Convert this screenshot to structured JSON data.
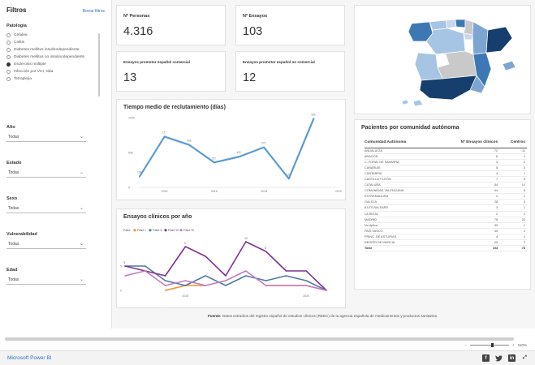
{
  "filters": {
    "title": "Filtros",
    "clear_label": "Borrar filtros",
    "patologia": {
      "label": "Patología",
      "options": [
        {
          "label": "Cefalea",
          "selected": false
        },
        {
          "label": "Colitis",
          "selected": false
        },
        {
          "label": "Diabetes mellitus insulinodependiente",
          "selected": false
        },
        {
          "label": "Diabetes mellitus no insulinodependiente",
          "selected": false
        },
        {
          "label": "Esclerosis múltiple",
          "selected": true
        },
        {
          "label": "Infección por VIH, sida",
          "selected": false
        },
        {
          "label": "Tetraplejia",
          "selected": false
        }
      ]
    },
    "ano": {
      "label": "Año",
      "value": "Todas"
    },
    "estado": {
      "label": "Estado",
      "value": "Todas"
    },
    "sexo": {
      "label": "Sexo",
      "value": "Todas"
    },
    "vulnerabilidad": {
      "label": "Vulnerabilidad",
      "value": "Todas"
    },
    "edad": {
      "label": "Edad",
      "value": "Todas"
    }
  },
  "kpis": {
    "personas": {
      "label": "Nº Personas",
      "value": "4.316"
    },
    "ensayos": {
      "label": "Nº Ensayos",
      "value": "103"
    },
    "promotor_comercial": {
      "label": "Ensayos promotor español comercial",
      "value": "13"
    },
    "promotor_no_comercial": {
      "label": "Ensayos promotor español no comercial",
      "value": "12"
    }
  },
  "map": {
    "regions": [
      {
        "name": "Galicia",
        "color": "#3d78b4"
      },
      {
        "name": "Asturias",
        "color": "#a6c4e3"
      },
      {
        "name": "Cantabria",
        "color": "#c6d8ec"
      },
      {
        "name": "País Vasco",
        "color": "#3d78b4"
      },
      {
        "name": "Navarra",
        "color": "#c9c9c9"
      },
      {
        "name": "Aragón",
        "color": "#7da5d1"
      },
      {
        "name": "Cataluña",
        "color": "#163f6e"
      },
      {
        "name": "Castilla y León",
        "color": "#a6c4e3"
      },
      {
        "name": "La Rioja",
        "color": "#c6d8ec"
      },
      {
        "name": "Madrid",
        "color": "#163f6e"
      },
      {
        "name": "Castilla-La Mancha",
        "color": "#c9c9c9"
      },
      {
        "name": "Extremadura",
        "color": "#a6c4e3"
      },
      {
        "name": "Valencia",
        "color": "#3d78b4"
      },
      {
        "name": "Murcia",
        "color": "#7da5d1"
      },
      {
        "name": "Andalucía",
        "color": "#163f6e"
      },
      {
        "name": "Baleares",
        "color": "#7da5d1"
      },
      {
        "name": "Canarias",
        "color": "#a6c4e3"
      }
    ]
  },
  "recruitment_chart": {
    "title": "Tiempo medio de reclutamiento (días)",
    "line_color": "#5b9bd5",
    "chart_data": {
      "type": "line",
      "x": [
        "2014",
        "2015",
        "2016",
        "2017",
        "2018",
        "2019",
        "2020",
        "2021",
        "2022"
      ],
      "x_tick_labels": [
        {
          "label": "2015",
          "index": 1
        },
        {
          "label": "2016",
          "index": 3
        },
        {
          "label": "2018",
          "index": 5
        },
        {
          "label": "2020",
          "index": 8
        }
      ],
      "y_ticks": [
        0,
        500,
        1000
      ],
      "values": [
        156,
        727,
        608,
        357,
        439,
        574,
        125,
        985
      ],
      "ylim": [
        0,
        1000
      ],
      "point_labels": [
        "156",
        "727",
        "608",
        "357",
        "439",
        "574",
        "125",
        "985"
      ]
    }
  },
  "trials_chart": {
    "title": "Ensayos clínicos por año",
    "legend_title": "Fase",
    "chart_data": {
      "type": "line",
      "x_tick_labels": [
        {
          "label": "2015",
          "index": 3
        },
        {
          "label": "2020",
          "index": 9
        }
      ],
      "y_ticks": [
        0,
        5
      ],
      "ylim": [
        0,
        10
      ],
      "series": [
        {
          "name": "Fase I",
          "color": "#f28e2b",
          "values": [
            null,
            null,
            0,
            1,
            1,
            null,
            null,
            1,
            1,
            1,
            0
          ]
        },
        {
          "name": "Fase II",
          "color": "#4e79a7",
          "values": [
            5,
            5,
            2,
            1,
            3,
            1,
            3,
            2,
            3,
            2,
            0
          ]
        },
        {
          "name": "Fase III",
          "color": "#7b3294",
          "values": [
            5,
            4,
            3,
            9,
            7,
            3,
            10,
            8,
            4,
            4,
            0
          ]
        },
        {
          "name": "Fase IV",
          "color": "#c07bc1",
          "values": [
            3,
            4,
            1,
            2,
            1,
            2,
            4,
            1,
            1,
            1,
            0
          ]
        }
      ],
      "point_labels": [
        {
          "series": 1,
          "index": 0,
          "text": "5"
        },
        {
          "series": 2,
          "index": 3,
          "text": "9"
        },
        {
          "series": 2,
          "index": 6,
          "text": "10"
        },
        {
          "series": 2,
          "index": 7,
          "text": "8"
        },
        {
          "series": 2,
          "index": 8,
          "text": "4"
        }
      ]
    }
  },
  "patients_table": {
    "title": "Pacientes por comunidad autónoma",
    "columns": [
      "Comunidad Autónoma",
      "Nº Ensayos clínicos",
      "Centros"
    ],
    "rows": [
      [
        "ANDALUCÍA",
        "72",
        "11"
      ],
      [
        "ARAGÓN",
        "8",
        "1"
      ],
      [
        "C. FORAL DE NAVARRA",
        "3",
        "2"
      ],
      [
        "CANARIAS",
        "5",
        "2"
      ],
      [
        "CANTABRIA",
        "4",
        "1"
      ],
      [
        "CASTILLA Y LEÓN",
        "7",
        "5"
      ],
      [
        "CATALUÑA",
        "84",
        "14"
      ],
      [
        "COMUNIDAD VALENCIANA",
        "44",
        "8"
      ],
      [
        "EXTREMADURA",
        "2",
        "1"
      ],
      [
        "GALICIA",
        "28",
        "3"
      ],
      [
        "ILLES BALEARS",
        "3",
        "1"
      ],
      [
        "LA RIOJA",
        "2",
        "1"
      ],
      [
        "MADRID",
        "78",
        "22"
      ],
      [
        "No Aplica",
        "30",
        "1"
      ],
      [
        "PAÍS VASCO",
        "40",
        "4"
      ],
      [
        "PRINC. DE ASTURIAS",
        "4",
        "1"
      ],
      [
        "REGIÓN DE MURCIA",
        "20",
        "2"
      ]
    ],
    "total": [
      "Total",
      "103",
      "78"
    ]
  },
  "source": {
    "bold": "Fuente:",
    "text": "Datos extraídos del registro español de estudios clínicos (REEC) de la agencia española de medicamentos y productos sanitarios."
  },
  "footer": {
    "powerbi_label": "Microsoft Power BI",
    "zoom_value": "110%",
    "zoom_minus": "−",
    "zoom_plus": "+",
    "share_icons": [
      "facebook-icon",
      "twitter-icon",
      "linkedin-icon",
      "fullscreen-icon"
    ]
  }
}
